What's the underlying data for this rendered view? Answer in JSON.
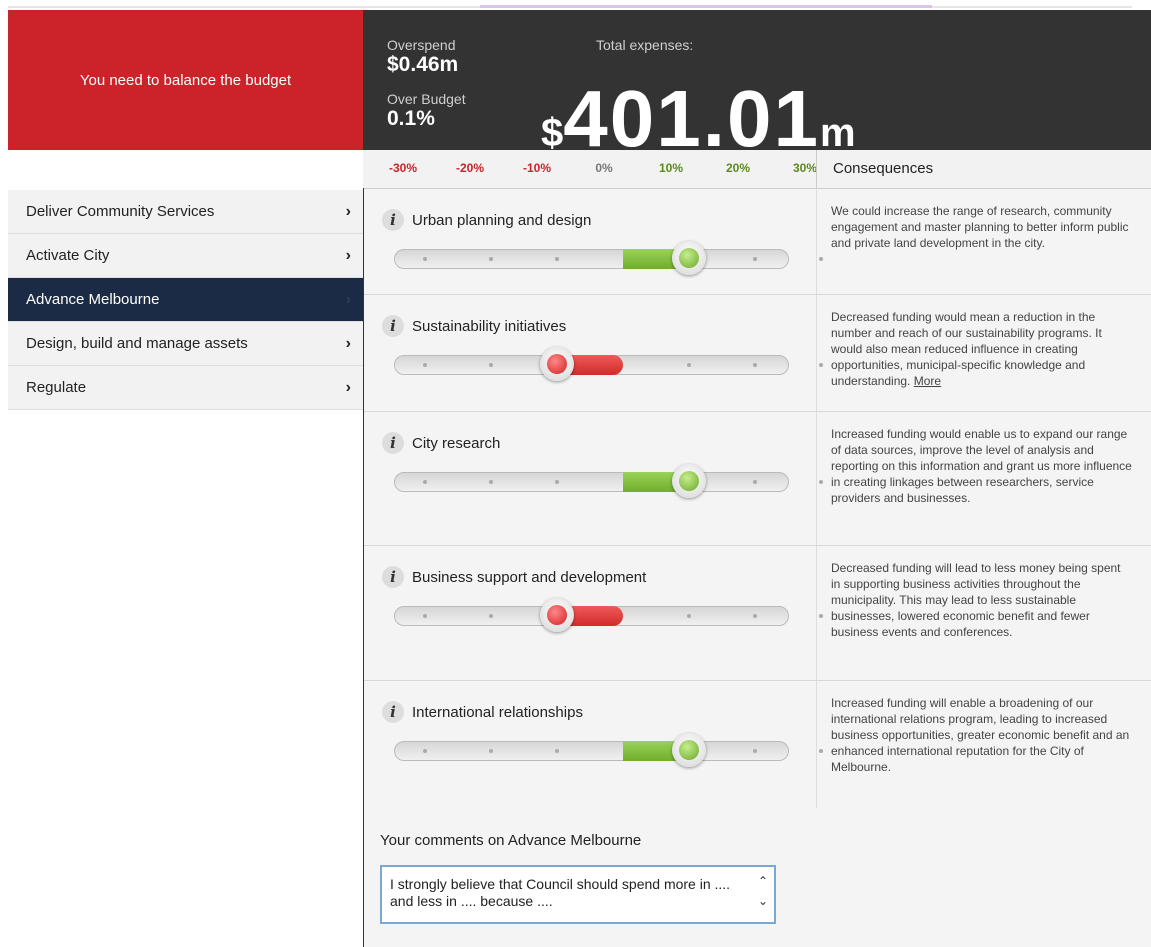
{
  "header": {
    "alert_text": "You need to balance the budget",
    "overspend_label": "Overspend",
    "overspend_value": "$0.46m",
    "over_budget_label": "Over Budget",
    "over_budget_value": "0.1%",
    "total_label": "Total expenses:",
    "total_currency": "$",
    "total_number": "401.01",
    "total_unit": "m"
  },
  "scale": {
    "ticks": [
      "-30%",
      "-20%",
      "-10%",
      "0%",
      "10%",
      "20%",
      "30%"
    ],
    "consequences_label": "Consequences"
  },
  "sidebar": {
    "items": [
      {
        "label": "Deliver Community Services",
        "active": false
      },
      {
        "label": "Activate City",
        "active": false
      },
      {
        "label": "Advance Melbourne",
        "active": true
      },
      {
        "label": "Design, build and manage assets",
        "active": false
      },
      {
        "label": "Regulate",
        "active": false
      }
    ],
    "chevron": "›"
  },
  "colors": {
    "alert_red": "#cc2229",
    "header_dark": "#333333",
    "nav_active": "#1c2b45",
    "positive_green": "#6fae2a",
    "negative_red": "#d22a2a"
  },
  "rows": [
    {
      "title": "Urban planning and design",
      "change_percent": 10,
      "consequence": "We could increase the range of research, community engagement and master planning to better inform public and private land development in the city.",
      "more_link": ""
    },
    {
      "title": "Sustainability initiatives",
      "change_percent": -10,
      "consequence": "Decreased funding would mean a reduction in the number and reach of our sustainability programs. It would also mean reduced influence in creating opportunities, municipal-specific knowledge and understanding.",
      "more_link": "More"
    },
    {
      "title": "City research",
      "change_percent": 10,
      "consequence": "Increased funding would enable us to expand our range of data sources, improve the level of analysis and reporting on this information and grant us more influence in creating linkages between researchers, service providers and businesses.",
      "more_link": ""
    },
    {
      "title": "Business support and development",
      "change_percent": -10,
      "consequence": "Decreased funding will lead to less money being spent in supporting business activities throughout the municipality. This may lead to less sustainable businesses, lowered economic benefit and fewer business events and conferences.",
      "more_link": ""
    },
    {
      "title": "International relationships",
      "change_percent": 10,
      "consequence": "Increased funding will enable a broadening of our international relations program, leading to increased business opportunities, greater economic benefit and an enhanced international reputation for the City of Melbourne.",
      "more_link": ""
    }
  ],
  "info_icon_glyph": "i",
  "comments": {
    "heading": "Your comments on Advance Melbourne",
    "value": "I strongly believe that Council should spend more in .... and less in .... because ....",
    "scroll_up": "⌃",
    "scroll_down": "⌄"
  }
}
